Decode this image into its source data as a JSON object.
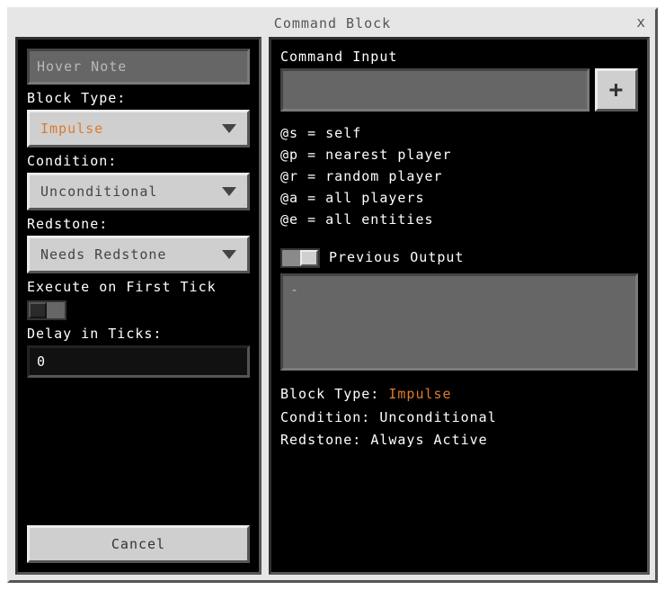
{
  "window": {
    "title": "Command Block",
    "close": "x"
  },
  "left": {
    "hoverNote_placeholder": "Hover Note",
    "blockType_label": "Block Type:",
    "blockType_value": "Impulse",
    "condition_label": "Condition:",
    "condition_value": "Unconditional",
    "redstone_label": "Redstone:",
    "redstone_value": "Needs Redstone",
    "execFirst_label": "Execute on First Tick",
    "delay_label": "Delay in Ticks:",
    "delay_value": "0",
    "cancel": "Cancel"
  },
  "right": {
    "commandInput_label": "Command Input",
    "plus": "+",
    "refs": {
      "s": "@s = self",
      "p": "@p = nearest player",
      "r": "@r = random player",
      "a": "@a = all players",
      "e": "@e = all entities"
    },
    "prevOutput_label": "Previous Output",
    "output_text": "-",
    "summary": {
      "blockType_label": "Block Type: ",
      "blockType_value": "Impulse",
      "condition_label": "Condition: ",
      "condition_value": "Unconditional",
      "redstone_label": "Redstone: ",
      "redstone_value": "Always Active"
    }
  }
}
